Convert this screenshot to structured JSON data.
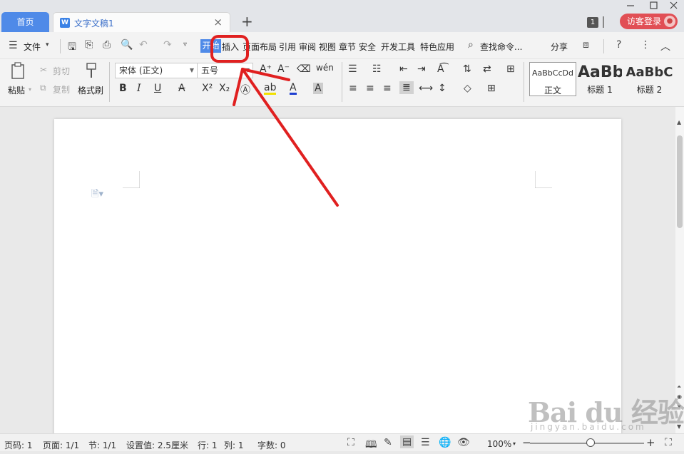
{
  "tabs": {
    "home": "首页",
    "doc_title": "文字文稿1",
    "doc_icon": "W",
    "new_tab": "+",
    "close": "×"
  },
  "window": {
    "count": "1",
    "guest_login": "访客登录"
  },
  "menu": {
    "file": "文件",
    "items": [
      "开始",
      "插入",
      "页面布局",
      "引用",
      "审阅",
      "视图",
      "章节",
      "安全",
      "开发工具",
      "特色应用"
    ],
    "search": "查找命令...",
    "share": "分享"
  },
  "ribbon": {
    "paste": "粘贴",
    "cut": "剪切",
    "copy": "复制",
    "format_painter": "格式刷",
    "font_name": "宋体 (正文)",
    "font_size": "五号",
    "styles": [
      {
        "sample": "AaBbCcDd",
        "label": "正文"
      },
      {
        "sample": "AaBb",
        "label": "标题 1"
      },
      {
        "sample": "AaBbC",
        "label": "标题 2"
      }
    ]
  },
  "statusbar": {
    "page_num": "页码: 1",
    "pages": "页面: 1/1",
    "section": "节: 1/1",
    "setting": "设置值: 2.5厘米",
    "row": "行: 1",
    "col": "列: 1",
    "words": "字数: 0",
    "zoom": "100%",
    "zoom_minus": "−",
    "zoom_plus": "+"
  },
  "watermark": {
    "brand": "Bai du 经验",
    "url": "jingyan.baidu.com"
  },
  "colors": {
    "accent": "#4f8ae8",
    "guest": "#e14f55",
    "annotation": "#e02020"
  }
}
